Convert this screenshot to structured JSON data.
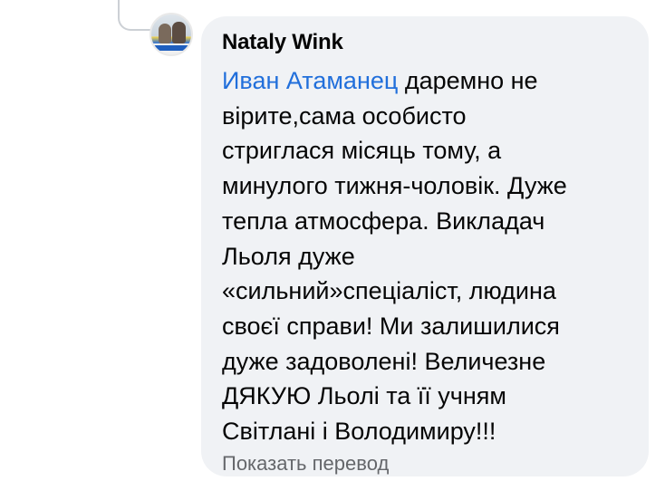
{
  "comment": {
    "author": "Nataly Wink",
    "mention": "Иван Атаманец",
    "lines": [
      " даремно не",
      "вірите,сама особисто",
      "стриглася місяць тому, а",
      "минулого тижня-чоловік. Дуже",
      "тепла атмосфера. Викладач",
      "Льоля дуже",
      "«сильний»спеціаліст, людина",
      "своєї справи! Ми залишилися",
      "дуже задоволені! Величезне",
      "ДЯКУЮ Льолі та її учням",
      "Світлані і Володимиру!!!"
    ],
    "translate_link": "Показать перевод"
  },
  "colors": {
    "bubble_background": "#f0f2f5",
    "mention": "#216fdb",
    "secondary_text": "#65676b",
    "primary_text": "#050505"
  }
}
